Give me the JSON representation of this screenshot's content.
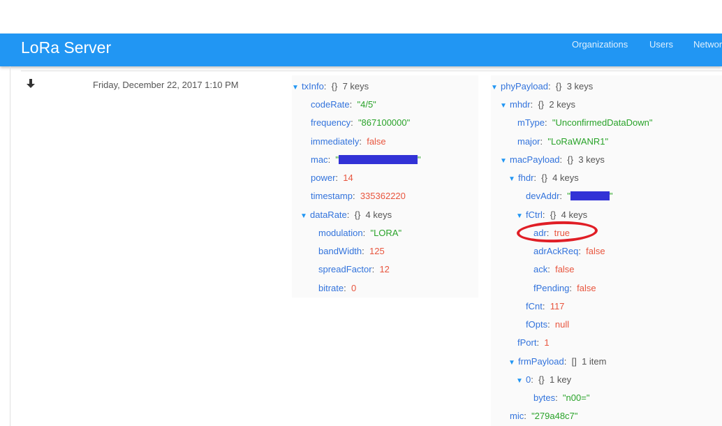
{
  "app": {
    "title": "LoRa Server"
  },
  "nav": {
    "items": [
      "Organizations",
      "Users",
      "Networ"
    ]
  },
  "row": {
    "timestamp": "Friday, December 22, 2017 1:10 PM"
  },
  "txInfo": {
    "key": "txInfo",
    "summary_brace": "{}",
    "summary": "7 keys",
    "codeRate": {
      "key": "codeRate",
      "value": "\"4/5\""
    },
    "frequency": {
      "key": "frequency",
      "value": "\"867100000\""
    },
    "immediately": {
      "key": "immediately",
      "value": "false"
    },
    "mac": {
      "key": "mac",
      "q1": "\"",
      "q2": "\""
    },
    "power": {
      "key": "power",
      "value": "14"
    },
    "timestamp": {
      "key": "timestamp",
      "value": "335362220"
    },
    "dataRate": {
      "key": "dataRate",
      "summary_brace": "{}",
      "summary": "4 keys",
      "modulation": {
        "key": "modulation",
        "value": "\"LORA\""
      },
      "bandWidth": {
        "key": "bandWidth",
        "value": "125"
      },
      "spreadFactor": {
        "key": "spreadFactor",
        "value": "12"
      },
      "bitrate": {
        "key": "bitrate",
        "value": "0"
      }
    }
  },
  "phyPayload": {
    "key": "phyPayload",
    "summary_brace": "{}",
    "summary": "3 keys",
    "mhdr": {
      "key": "mhdr",
      "summary_brace": "{}",
      "summary": "2 keys",
      "mType": {
        "key": "mType",
        "value": "\"UnconfirmedDataDown\""
      },
      "major": {
        "key": "major",
        "value": "\"LoRaWANR1\""
      }
    },
    "macPayload": {
      "key": "macPayload",
      "summary_brace": "{}",
      "summary": "3 keys",
      "fhdr": {
        "key": "fhdr",
        "summary_brace": "{}",
        "summary": "4 keys",
        "devAddr": {
          "key": "devAddr",
          "q1": "\"",
          "q2": "\""
        },
        "fCtrl": {
          "key": "fCtrl",
          "summary_brace": "{}",
          "summary": "4 keys",
          "adr": {
            "key": "adr",
            "value": "true"
          },
          "adrAckReq": {
            "key": "adrAckReq",
            "value": "false"
          },
          "ack": {
            "key": "ack",
            "value": "false"
          },
          "fPending": {
            "key": "fPending",
            "value": "false"
          }
        },
        "fCnt": {
          "key": "fCnt",
          "value": "117"
        },
        "fOpts": {
          "key": "fOpts",
          "value": "null"
        }
      },
      "fPort": {
        "key": "fPort",
        "value": "1"
      },
      "frmPayload": {
        "key": "frmPayload",
        "summary_brace": "[]",
        "summary": "1 item",
        "item0": {
          "key": "0",
          "summary_brace": "{}",
          "summary": "1 key",
          "bytes": {
            "key": "bytes",
            "value": "\"n00=\""
          }
        }
      }
    },
    "mic": {
      "key": "mic",
      "value": "\"279a48c7\""
    }
  },
  "colors": {
    "appbar": "#2196f3",
    "key": "#3273dc",
    "string": "#29a329",
    "number": "#e8553e",
    "highlight": "#e01e26"
  }
}
